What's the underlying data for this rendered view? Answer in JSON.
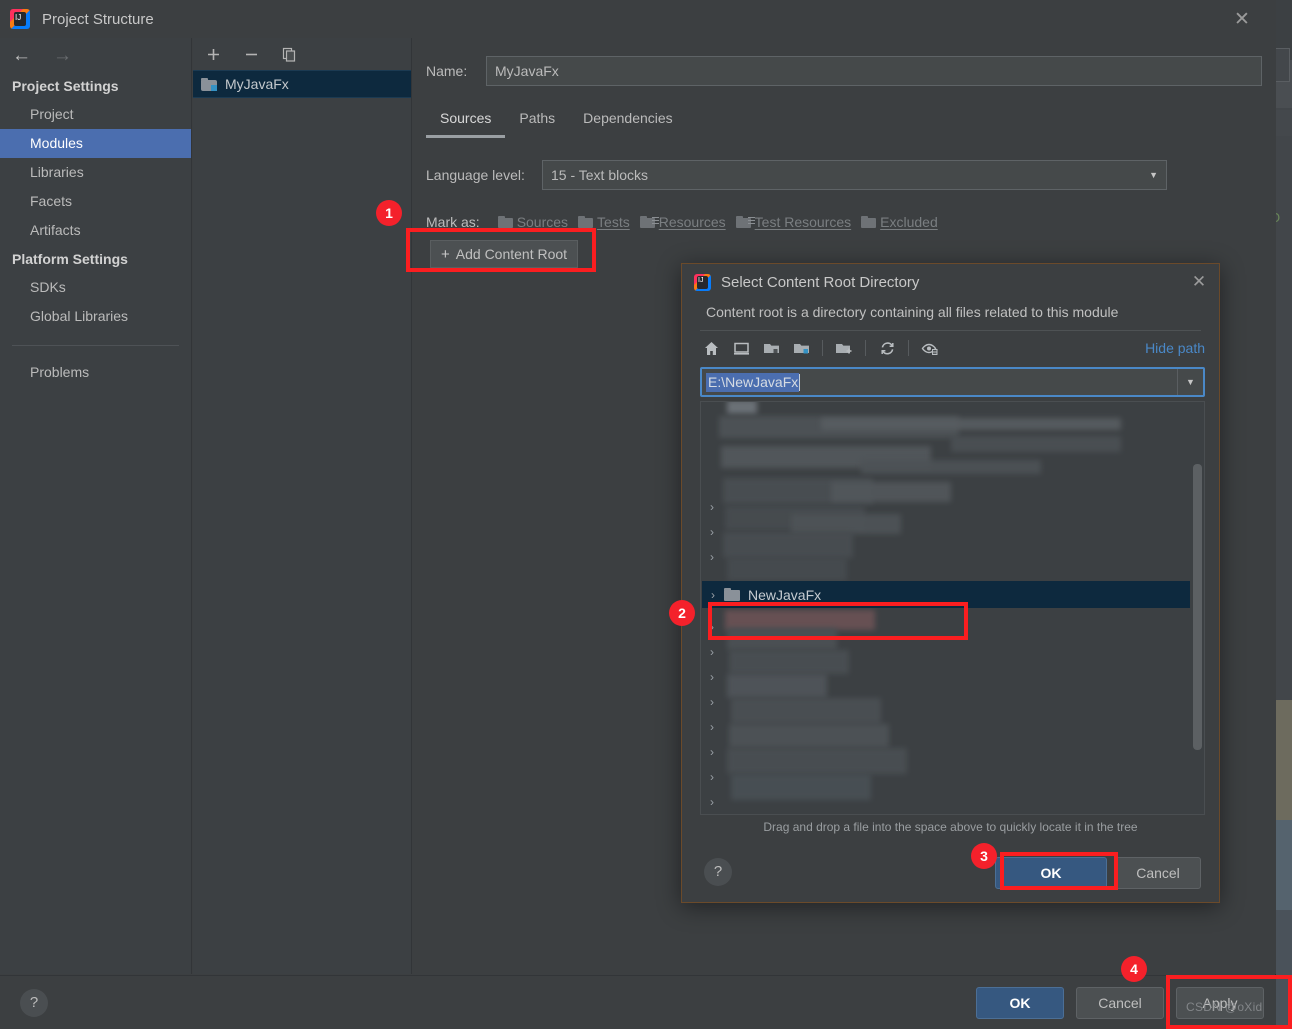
{
  "window": {
    "title": "Project Structure",
    "close_icon": "close-icon"
  },
  "sidebar": {
    "back_icon": "arrow-left-icon",
    "forward_icon": "arrow-right-icon",
    "groups": [
      {
        "title": "Project Settings",
        "items": [
          "Project",
          "Modules",
          "Libraries",
          "Facets",
          "Artifacts"
        ]
      },
      {
        "title": "Platform Settings",
        "items": [
          "SDKs",
          "Global Libraries"
        ]
      }
    ],
    "selected": "Modules",
    "problems": "Problems"
  },
  "modules_panel": {
    "toolbar": {
      "add": "+",
      "remove": "−",
      "copy_icon": "copy-icon"
    },
    "items": [
      {
        "name": "MyJavaFx",
        "selected": true
      }
    ]
  },
  "main": {
    "name_label": "Name:",
    "name_value": "MyJavaFx",
    "tabs": [
      {
        "label": "Sources",
        "active": true
      },
      {
        "label": "Paths",
        "active": false
      },
      {
        "label": "Dependencies",
        "active": false
      }
    ],
    "language_level_label": "Language level:",
    "language_level_value": "15 - Text blocks",
    "mark_as_label": "Mark as:",
    "mark_as_options": [
      "Sources",
      "Tests",
      "Resources",
      "Test Resources",
      "Excluded"
    ],
    "add_content_root": "Add Content Root"
  },
  "bottom_bar": {
    "help_icon": "question-mark-icon",
    "ok": "OK",
    "cancel": "Cancel",
    "apply": "Apply"
  },
  "chooser": {
    "title": "Select Content Root Directory",
    "close_icon": "close-icon",
    "description": "Content root is a directory containing all files related to this module",
    "toolbar_icons": [
      "home-icon",
      "desktop-icon",
      "folder-module-icon",
      "folder-project-icon",
      "new-folder-icon",
      "refresh-icon",
      "show-hidden-files-icon"
    ],
    "hide_path": "Hide path",
    "path_value": "E:\\NewJavaFx",
    "path_dropdown_icon": "chevron-down-icon",
    "selected_node": "NewJavaFx",
    "hint": "Drag and drop a file into the space above to quickly locate it in the tree",
    "help_icon": "question-mark-icon",
    "ok": "OK",
    "cancel": "Cancel"
  },
  "annotations": {
    "badges": [
      "1",
      "2",
      "3",
      "4"
    ],
    "highlight_color": "#fb1e20"
  },
  "watermark": "CSDN @oXid"
}
